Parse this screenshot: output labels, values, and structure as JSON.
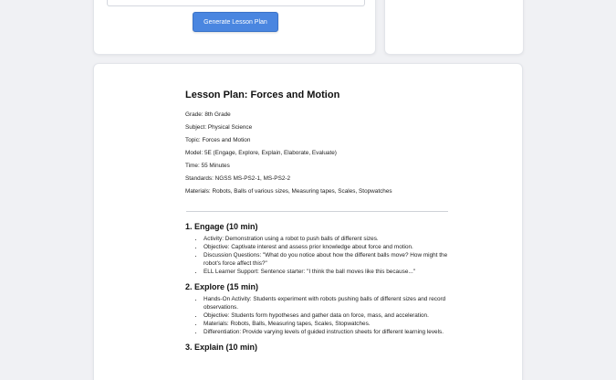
{
  "form": {
    "generate_button": "Generate Lesson Plan"
  },
  "lesson": {
    "title": "Lesson Plan: Forces and Motion",
    "meta": [
      "Grade: 8th Grade",
      "Subject: Physical Science",
      "Topic: Forces and Motion",
      "Model: 5E (Engage, Explore, Explain, Elaborate, Evaluate)",
      "Time: 55 Minutes",
      "Standards: NGSS MS-PS2-1, MS-PS2-2",
      "Materials: Robots, Balls of various sizes, Measuring tapes, Scales, Stopwatches"
    ],
    "sections": [
      {
        "title": "1. Engage (10 min)",
        "items": [
          "Activity: Demonstration using a robot to push balls of different sizes.",
          "Objective: Captivate interest and assess prior knowledge about force and motion.",
          "Discussion Questions: \"What do you notice about how the different balls move? How might the robot's force affect this?\"",
          "ELL Learner Support: Sentence starter: \"I think the ball moves like this because...\""
        ]
      },
      {
        "title": "2. Explore (15 min)",
        "items": [
          "Hands-On Activity: Students experiment with robots pushing balls of different sizes and record observations.",
          "Objective: Students form hypotheses and gather data on force, mass, and acceleration.",
          "Materials: Robots, Balls, Measuring tapes, Scales, Stopwatches.",
          "Differentiation: Provide varying levels of guided instruction sheets for different learning levels."
        ]
      },
      {
        "title": "3. Explain (10 min)",
        "items": []
      }
    ]
  }
}
